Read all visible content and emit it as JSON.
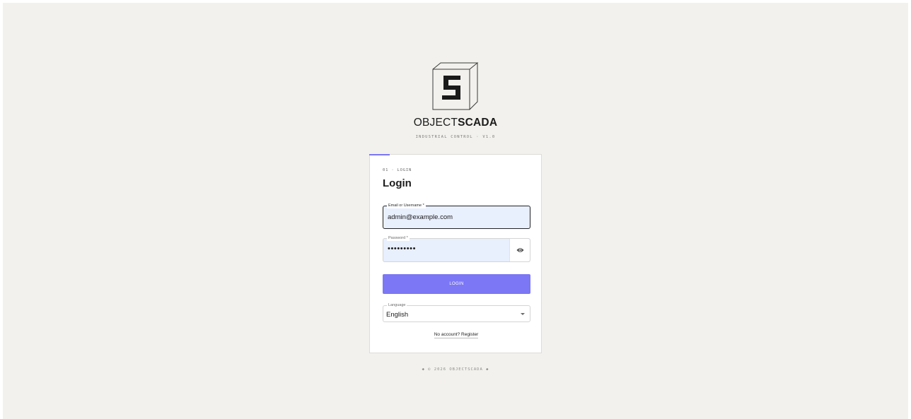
{
  "brand": {
    "name_light": "OBJECT",
    "name_bold": "SCADA",
    "logo_letter": "S",
    "tagline": "INDUSTRIAL CONTROL · V1.0"
  },
  "card": {
    "step_label": "01 · LOGIN",
    "title": "Login"
  },
  "form": {
    "email": {
      "label": "Email or Username *",
      "value": "admin@example.com"
    },
    "password": {
      "label": "Password *",
      "masked_value": "•••••••••"
    },
    "login_button": "LOGIN",
    "language": {
      "label": "Language",
      "selected": "English"
    },
    "register_link": "No account? Register"
  },
  "footer": {
    "text": "◆ © 2026 OBJECTSCADA ◆"
  },
  "icons": {
    "logo": "objectscada-cube-logo-icon",
    "password_toggle": "eye-icon",
    "select_caret": "caret-down-icon"
  },
  "colors": {
    "page_background": "#f2f1ed",
    "accent": "#7b77f5",
    "input_fill": "#e8effd"
  }
}
